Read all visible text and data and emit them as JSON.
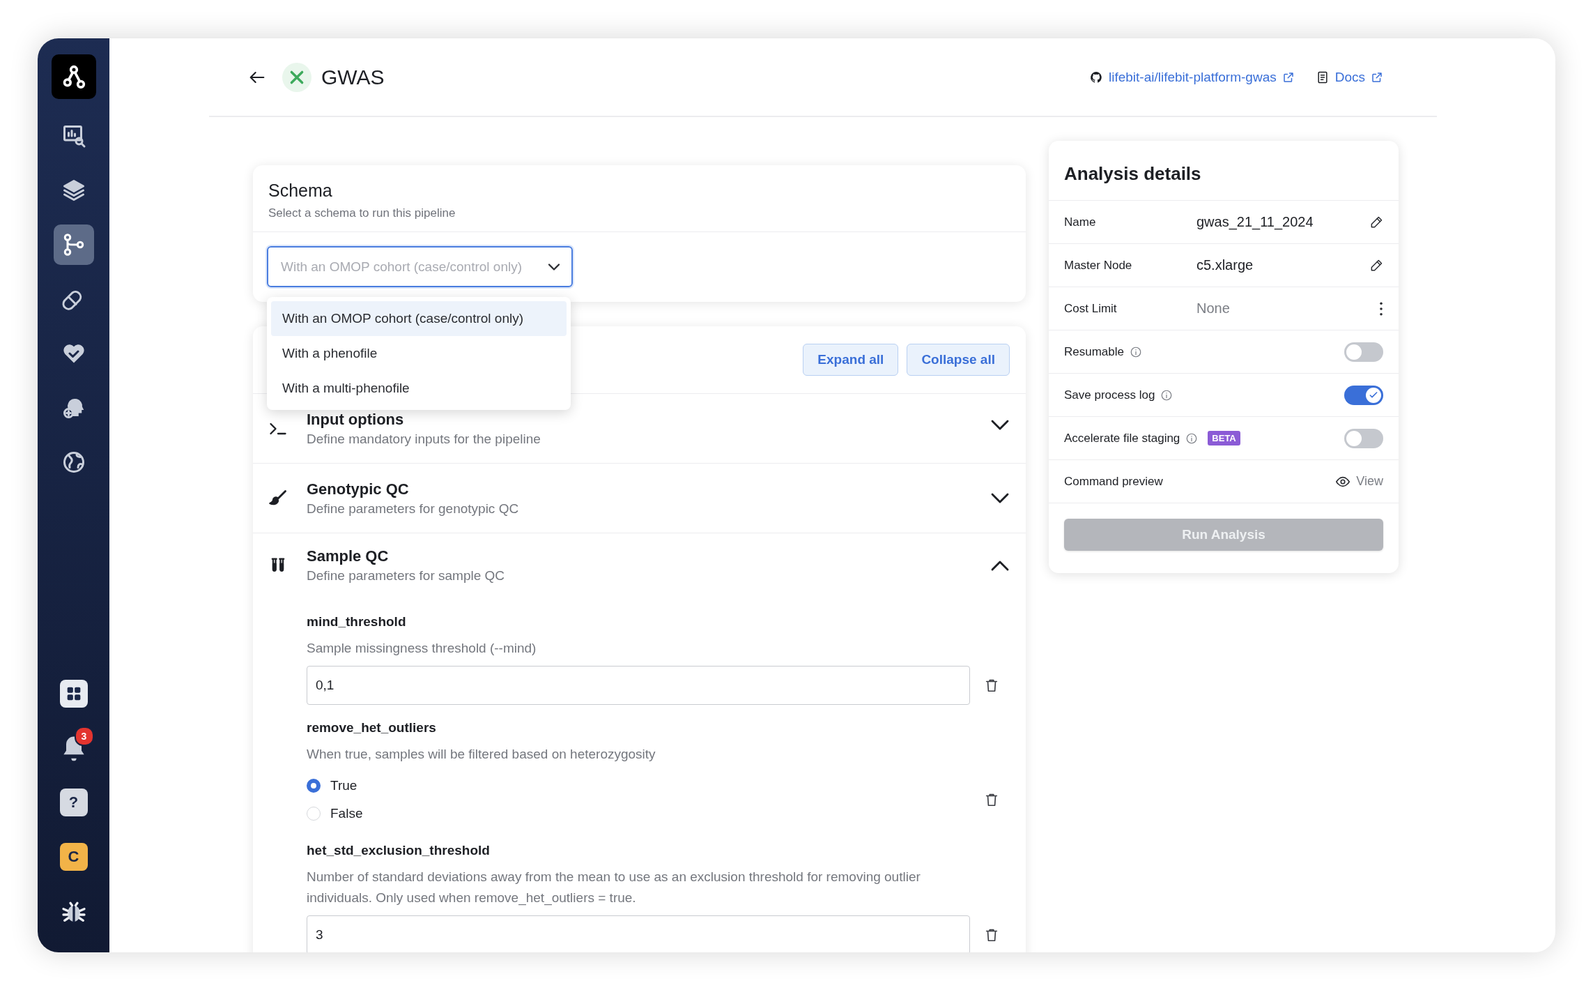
{
  "sidebar": {
    "nav": [
      {
        "selected": false
      },
      {
        "selected": false
      },
      {
        "selected": true
      },
      {
        "selected": false
      },
      {
        "selected": false
      },
      {
        "selected": false
      },
      {
        "selected": false
      }
    ],
    "notifications": {
      "badge": "3"
    },
    "help": "?",
    "avatar": "C"
  },
  "header": {
    "title": "GWAS",
    "links": [
      {
        "text": "lifebit-ai/lifebit-platform-gwas",
        "kind": "repo"
      },
      {
        "text": "Docs",
        "kind": "docs"
      }
    ]
  },
  "schema": {
    "title": "Schema",
    "subtitle": "Select a schema to run this pipeline",
    "select": {
      "placeholder": "With an OMOP cohort (case/control only)",
      "open": true
    },
    "options": [
      {
        "label": "With an OMOP cohort (case/control only)",
        "selected": true
      },
      {
        "label": "With a phenofile",
        "selected": false
      },
      {
        "label": "With a multi-phenofile",
        "selected": false
      }
    ]
  },
  "parameters": {
    "buttons": [
      "Expand all",
      "Collapse all"
    ],
    "sections": [
      {
        "title": "Input options",
        "subtitle": "Define mandatory inputs for the pipeline",
        "expanded": false
      },
      {
        "title": "Genotypic QC",
        "subtitle": "Define parameters for genotypic QC",
        "expanded": false
      },
      {
        "title": "Sample QC",
        "subtitle": "Define parameters for sample QC",
        "expanded": true,
        "fields": [
          {
            "kind": "text",
            "label": "mind_threshold",
            "description": "Sample missingness threshold (--mind)",
            "value": "0,1"
          },
          {
            "kind": "radio",
            "label": "remove_het_outliers",
            "description": "When true, samples will be filtered based on heterozygosity",
            "options": [
              {
                "label": "True",
                "selected": true
              },
              {
                "label": "False",
                "selected": false
              }
            ]
          },
          {
            "kind": "text",
            "label": "het_std_exclusion_threshold",
            "description": "Number of standard deviations away from the mean to use as an exclusion threshold for removing outlier individuals. Only used when remove_het_outliers = true.",
            "value": "3"
          }
        ]
      }
    ]
  },
  "analysis": {
    "title": "Analysis details",
    "rows": [
      {
        "kind": "edit",
        "label": "Name",
        "value": "gwas_21_11_2024"
      },
      {
        "kind": "edit",
        "label": "Master Node",
        "value": "c5.xlarge"
      },
      {
        "kind": "menu",
        "label": "Cost Limit",
        "value": "None"
      },
      {
        "kind": "toggle",
        "label": "Resumable",
        "on": false
      },
      {
        "kind": "toggle",
        "label": "Save process log",
        "on": true
      },
      {
        "kind": "toggle",
        "label": "Accelerate file staging",
        "on": false,
        "badge": "BETA"
      },
      {
        "kind": "view",
        "label": "Command preview",
        "action": "View"
      }
    ],
    "button": {
      "label": "Run Analysis",
      "disabled": true
    }
  }
}
